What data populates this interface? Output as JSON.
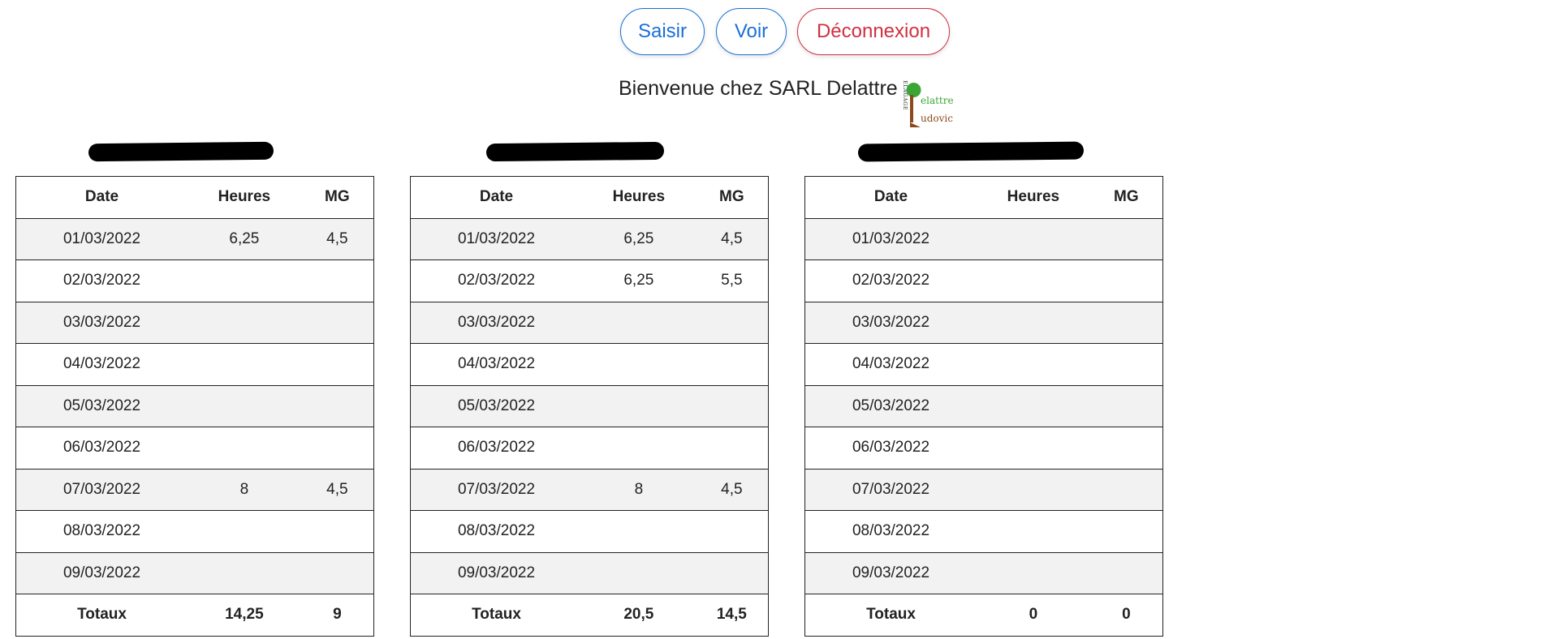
{
  "nav": {
    "saisir": "Saisir",
    "voir": "Voir",
    "deconnexion": "Déconnexion"
  },
  "welcome": "Bienvenue chez SARL Delattre",
  "logo": {
    "vertical": "ELAGAGE",
    "line1": "elattre",
    "line2": "udovic",
    "colors": {
      "green": "#3aa635",
      "brown": "#8a4a1c"
    }
  },
  "headers": {
    "date": "Date",
    "heures": "Heures",
    "mg": "MG"
  },
  "totals_label": "Totaux",
  "panels": [
    {
      "name": "",
      "rows": [
        {
          "date": "01/03/2022",
          "heures": "6,25",
          "mg": "4,5"
        },
        {
          "date": "02/03/2022",
          "heures": "",
          "mg": ""
        },
        {
          "date": "03/03/2022",
          "heures": "",
          "mg": ""
        },
        {
          "date": "04/03/2022",
          "heures": "",
          "mg": ""
        },
        {
          "date": "05/03/2022",
          "heures": "",
          "mg": ""
        },
        {
          "date": "06/03/2022",
          "heures": "",
          "mg": ""
        },
        {
          "date": "07/03/2022",
          "heures": "8",
          "mg": "4,5"
        },
        {
          "date": "08/03/2022",
          "heures": "",
          "mg": ""
        },
        {
          "date": "09/03/2022",
          "heures": "",
          "mg": ""
        }
      ],
      "totals": {
        "heures": "14,25",
        "mg": "9"
      }
    },
    {
      "name": "",
      "rows": [
        {
          "date": "01/03/2022",
          "heures": "6,25",
          "mg": "4,5"
        },
        {
          "date": "02/03/2022",
          "heures": "6,25",
          "mg": "5,5"
        },
        {
          "date": "03/03/2022",
          "heures": "",
          "mg": ""
        },
        {
          "date": "04/03/2022",
          "heures": "",
          "mg": ""
        },
        {
          "date": "05/03/2022",
          "heures": "",
          "mg": ""
        },
        {
          "date": "06/03/2022",
          "heures": "",
          "mg": ""
        },
        {
          "date": "07/03/2022",
          "heures": "8",
          "mg": "4,5"
        },
        {
          "date": "08/03/2022",
          "heures": "",
          "mg": ""
        },
        {
          "date": "09/03/2022",
          "heures": "",
          "mg": ""
        }
      ],
      "totals": {
        "heures": "20,5",
        "mg": "14,5"
      }
    },
    {
      "name": "",
      "rows": [
        {
          "date": "01/03/2022",
          "heures": "",
          "mg": ""
        },
        {
          "date": "02/03/2022",
          "heures": "",
          "mg": ""
        },
        {
          "date": "03/03/2022",
          "heures": "",
          "mg": ""
        },
        {
          "date": "04/03/2022",
          "heures": "",
          "mg": ""
        },
        {
          "date": "05/03/2022",
          "heures": "",
          "mg": ""
        },
        {
          "date": "06/03/2022",
          "heures": "",
          "mg": ""
        },
        {
          "date": "07/03/2022",
          "heures": "",
          "mg": ""
        },
        {
          "date": "08/03/2022",
          "heures": "",
          "mg": ""
        },
        {
          "date": "09/03/2022",
          "heures": "",
          "mg": ""
        }
      ],
      "totals": {
        "heures": "0",
        "mg": "0"
      }
    }
  ]
}
